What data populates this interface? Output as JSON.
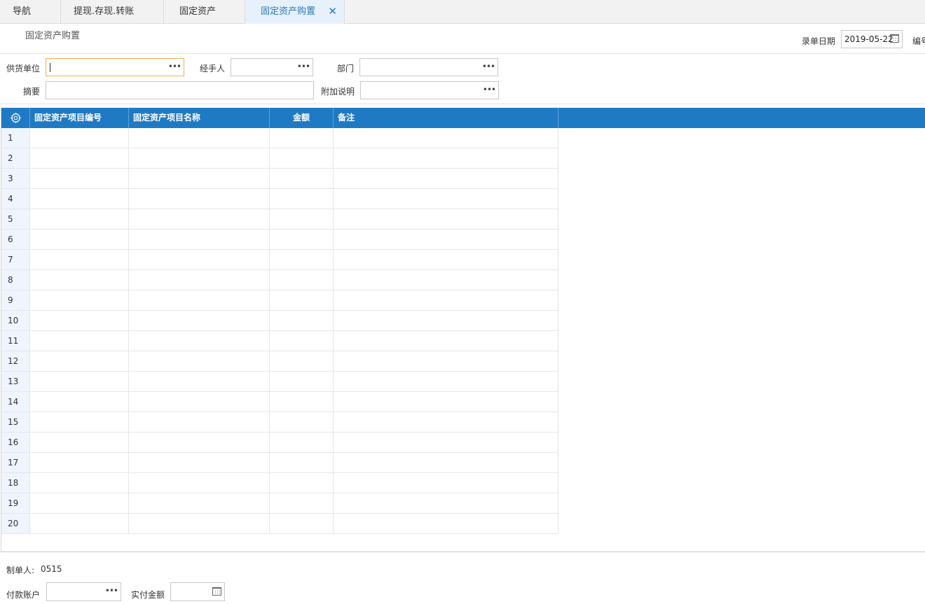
{
  "tabs": [
    {
      "label": "导航",
      "active": false
    },
    {
      "label": "提现.存现.转账",
      "active": false
    },
    {
      "label": "固定资产",
      "active": false
    },
    {
      "label": "固定资产购置",
      "active": true
    }
  ],
  "page_title": "固定资产购置",
  "header": {
    "date_label": "录单日期",
    "date_value": "2019-05-22",
    "number_label": "编号"
  },
  "form": {
    "supplier_label": "供货单位",
    "supplier_value": "",
    "handler_label": "经手人",
    "handler_value": "",
    "department_label": "部门",
    "department_value": "",
    "summary_label": "摘要",
    "summary_value": "",
    "note_label": "附加说明",
    "note_value": ""
  },
  "grid": {
    "columns": [
      "固定资产项目编号",
      "固定资产项目名称",
      "金额",
      "备注"
    ],
    "rows": [
      "1",
      "2",
      "3",
      "4",
      "5",
      "6",
      "7",
      "8",
      "9",
      "10",
      "11",
      "12",
      "13",
      "14",
      "15",
      "16",
      "17",
      "18",
      "19",
      "20"
    ]
  },
  "footer": {
    "creator_label": "制单人:",
    "creator_value": "0515",
    "account_label": "付款账户",
    "account_value": "",
    "paid_label": "实付金额",
    "paid_value": ""
  },
  "colors": {
    "accent": "#1f7ac4",
    "active_tab_bg": "#e7f1fb",
    "focus_border": "#f0b24a"
  },
  "icons": {
    "more": "ellipsis-icon",
    "calendar": "calendar-icon",
    "settings": "gear-icon",
    "close": "close-icon"
  }
}
